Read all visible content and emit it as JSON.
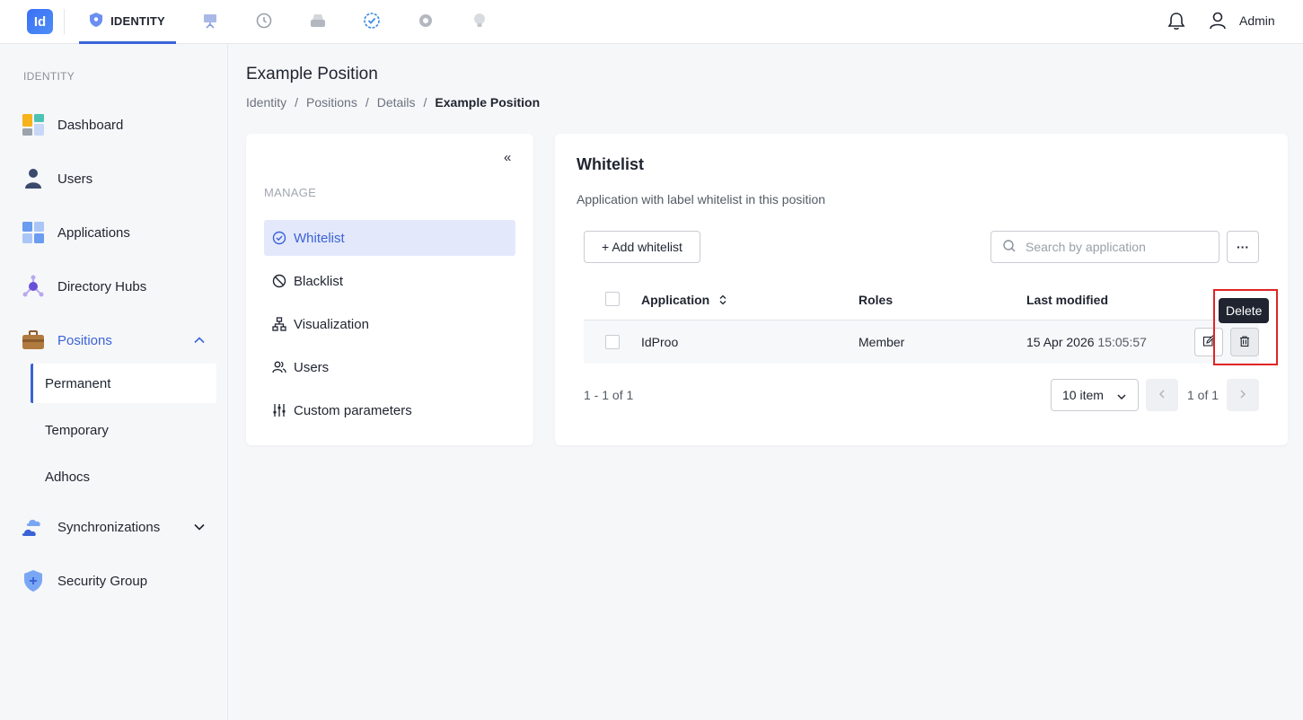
{
  "topbar": {
    "logo_text": "Id",
    "active_tab": "IDENTITY",
    "tab_icons": [
      "presentation-icon",
      "history-icon",
      "drive-icon",
      "check-badge-icon",
      "settings-icon",
      "lightbulb-icon"
    ],
    "user_name": "Admin"
  },
  "sidebar": {
    "section": "IDENTITY",
    "items": [
      {
        "label": "Dashboard",
        "icon": "dashboard-icon"
      },
      {
        "label": "Users",
        "icon": "user-icon"
      },
      {
        "label": "Applications",
        "icon": "applications-icon"
      },
      {
        "label": "Directory Hubs",
        "icon": "hub-icon"
      },
      {
        "label": "Positions",
        "icon": "briefcase-icon"
      },
      {
        "label": "Synchronizations",
        "icon": "cloud-sync-icon"
      },
      {
        "label": "Security Group",
        "icon": "shield-icon"
      }
    ],
    "positions_sub": [
      "Permanent",
      "Temporary",
      "Adhocs"
    ]
  },
  "page": {
    "title": "Example Position",
    "breadcrumb": [
      "Identity",
      "Positions",
      "Details",
      "Example Position"
    ],
    "breadcrumb_sep": "/"
  },
  "manage": {
    "label": "MANAGE",
    "collapse": "«",
    "items": [
      "Whitelist",
      "Blacklist",
      "Visualization",
      "Users",
      "Custom parameters"
    ]
  },
  "whitelist": {
    "title": "Whitelist",
    "description": "Application with label whitelist in this position",
    "add_button": "+ Add whitelist",
    "search_placeholder": "Search by application",
    "more_button": "···",
    "columns": [
      "Application",
      "Roles",
      "Last modified"
    ],
    "rows": [
      {
        "application": "IdProo",
        "roles": "Member",
        "date": "15 Apr 2026",
        "time": "15:05:57"
      }
    ],
    "tooltip": "Delete",
    "count": "1 - 1 of 1",
    "page_size": "10 item",
    "page_text": "1 of 1"
  },
  "colors": {
    "accent": "#3a63d8",
    "highlight": "#e02424"
  }
}
